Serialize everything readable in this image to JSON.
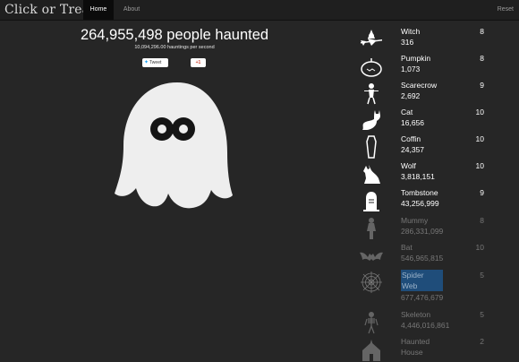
{
  "nav": {
    "brand": "Click or Treat",
    "home": "Home",
    "about": "About",
    "reset": "Reset"
  },
  "main": {
    "headline": "264,955,498 people haunted",
    "per_second": "10,094,296.00 hauntings per second",
    "tweet_label": "Tweet",
    "gplus_label": "+1"
  },
  "items": [
    {
      "name": "Witch",
      "count": "316",
      "owned": "8",
      "icon": "witch-icon"
    },
    {
      "name": "Pumpkin",
      "count": "1,073",
      "owned": "8",
      "icon": "pumpkin-icon"
    },
    {
      "name": "Scarecrow",
      "count": "2,692",
      "owned": "9",
      "icon": "scarecrow-icon"
    },
    {
      "name": "Cat",
      "count": "16,656",
      "owned": "10",
      "icon": "cat-icon"
    },
    {
      "name": "Coffin",
      "count": "24,357",
      "owned": "10",
      "icon": "coffin-icon"
    },
    {
      "name": "Wolf",
      "count": "3,818,151",
      "owned": "10",
      "icon": "wolf-icon"
    },
    {
      "name": "Tombstone",
      "count": "43,256,999",
      "owned": "9",
      "icon": "tombstone-icon"
    },
    {
      "name": "Mummy",
      "count": "286,331,099",
      "owned": "8",
      "icon": "mummy-icon"
    },
    {
      "name": "Bat",
      "count": "546,965,815",
      "owned": "10",
      "icon": "bat-icon"
    },
    {
      "name": "Spider",
      "name2": "Web",
      "count": "677,476,679",
      "owned": "5",
      "icon": "spider-web-icon"
    },
    {
      "name": "Skeleton",
      "count": "4,446,016,861",
      "owned": "5",
      "icon": "skeleton-icon"
    },
    {
      "name": "Haunted",
      "name2": "House",
      "owned": "2",
      "icon": "haunted-house-icon"
    }
  ],
  "colors": {
    "background": "#262626",
    "navbar": "#1f1f1f",
    "active_tab": "#0b0b0b",
    "locked_text": "#777777",
    "selected_highlight": "#1f4d7a",
    "ghost": "#eeeeee"
  }
}
